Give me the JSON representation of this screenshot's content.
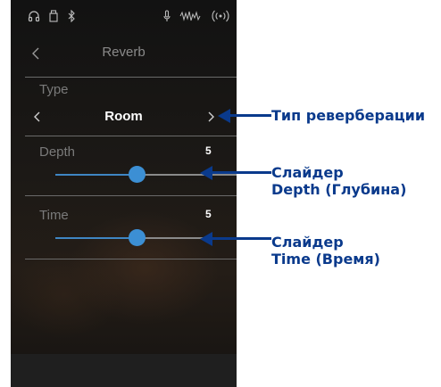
{
  "header": {
    "title": "Reverb"
  },
  "type_section": {
    "label": "Type",
    "value": "Room"
  },
  "depth_section": {
    "label": "Depth",
    "value": "5",
    "level_fraction": 0.5
  },
  "time_section": {
    "label": "Time",
    "value": "5",
    "level_fraction": 0.5
  },
  "callouts": {
    "type": "Тип реверберации",
    "depth_line1": "Слайдер",
    "depth_line2": "Depth (Глубина)",
    "time_line1": "Слайдер",
    "time_line2": "Time (Время)"
  },
  "status_icons": [
    "headphones-icon",
    "usb-memory-icon",
    "bluetooth-icon",
    "microphone-icon",
    "audio-waveform-icon",
    "wireless-icon"
  ],
  "colors": {
    "accent": "#3c8fd4",
    "callout": "#0a3a8c",
    "background": "#141414"
  }
}
